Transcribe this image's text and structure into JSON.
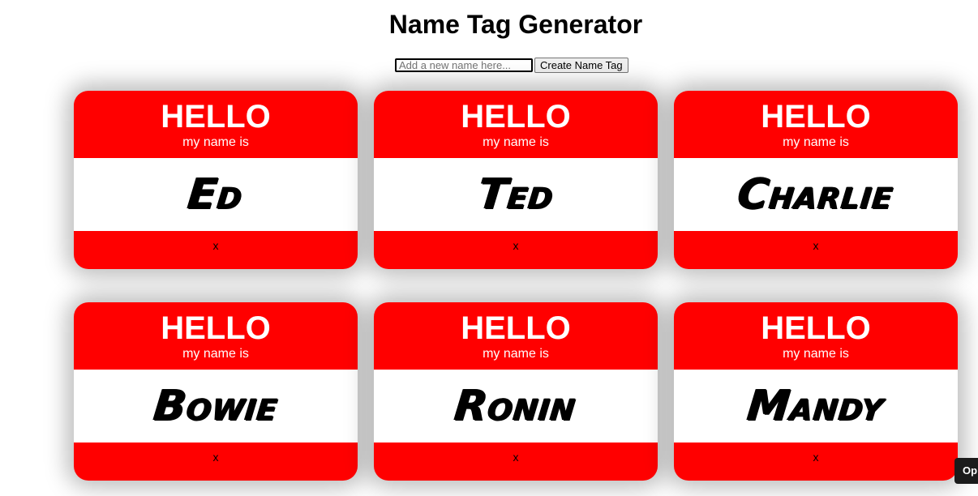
{
  "page": {
    "title": "Name Tag Generator"
  },
  "form": {
    "input_placeholder": "Add a new name here...",
    "input_value": "",
    "button_label": "Create Name Tag"
  },
  "tags": [
    {
      "hello": "HELLO",
      "subtitle": "my name is",
      "name": "Ed",
      "remove": "x"
    },
    {
      "hello": "HELLO",
      "subtitle": "my name is",
      "name": "Ted",
      "remove": "x"
    },
    {
      "hello": "HELLO",
      "subtitle": "my name is",
      "name": "Charlie",
      "remove": "x"
    },
    {
      "hello": "HELLO",
      "subtitle": "my name is",
      "name": "Bowie",
      "remove": "x"
    },
    {
      "hello": "HELLO",
      "subtitle": "my name is",
      "name": "Ronin",
      "remove": "x"
    },
    {
      "hello": "HELLO",
      "subtitle": "my name is",
      "name": "Mandy",
      "remove": "x"
    }
  ],
  "corner_badge": {
    "label": "Op"
  },
  "colors": {
    "tag_red": "#ff0000",
    "tag_white": "#ffffff"
  }
}
